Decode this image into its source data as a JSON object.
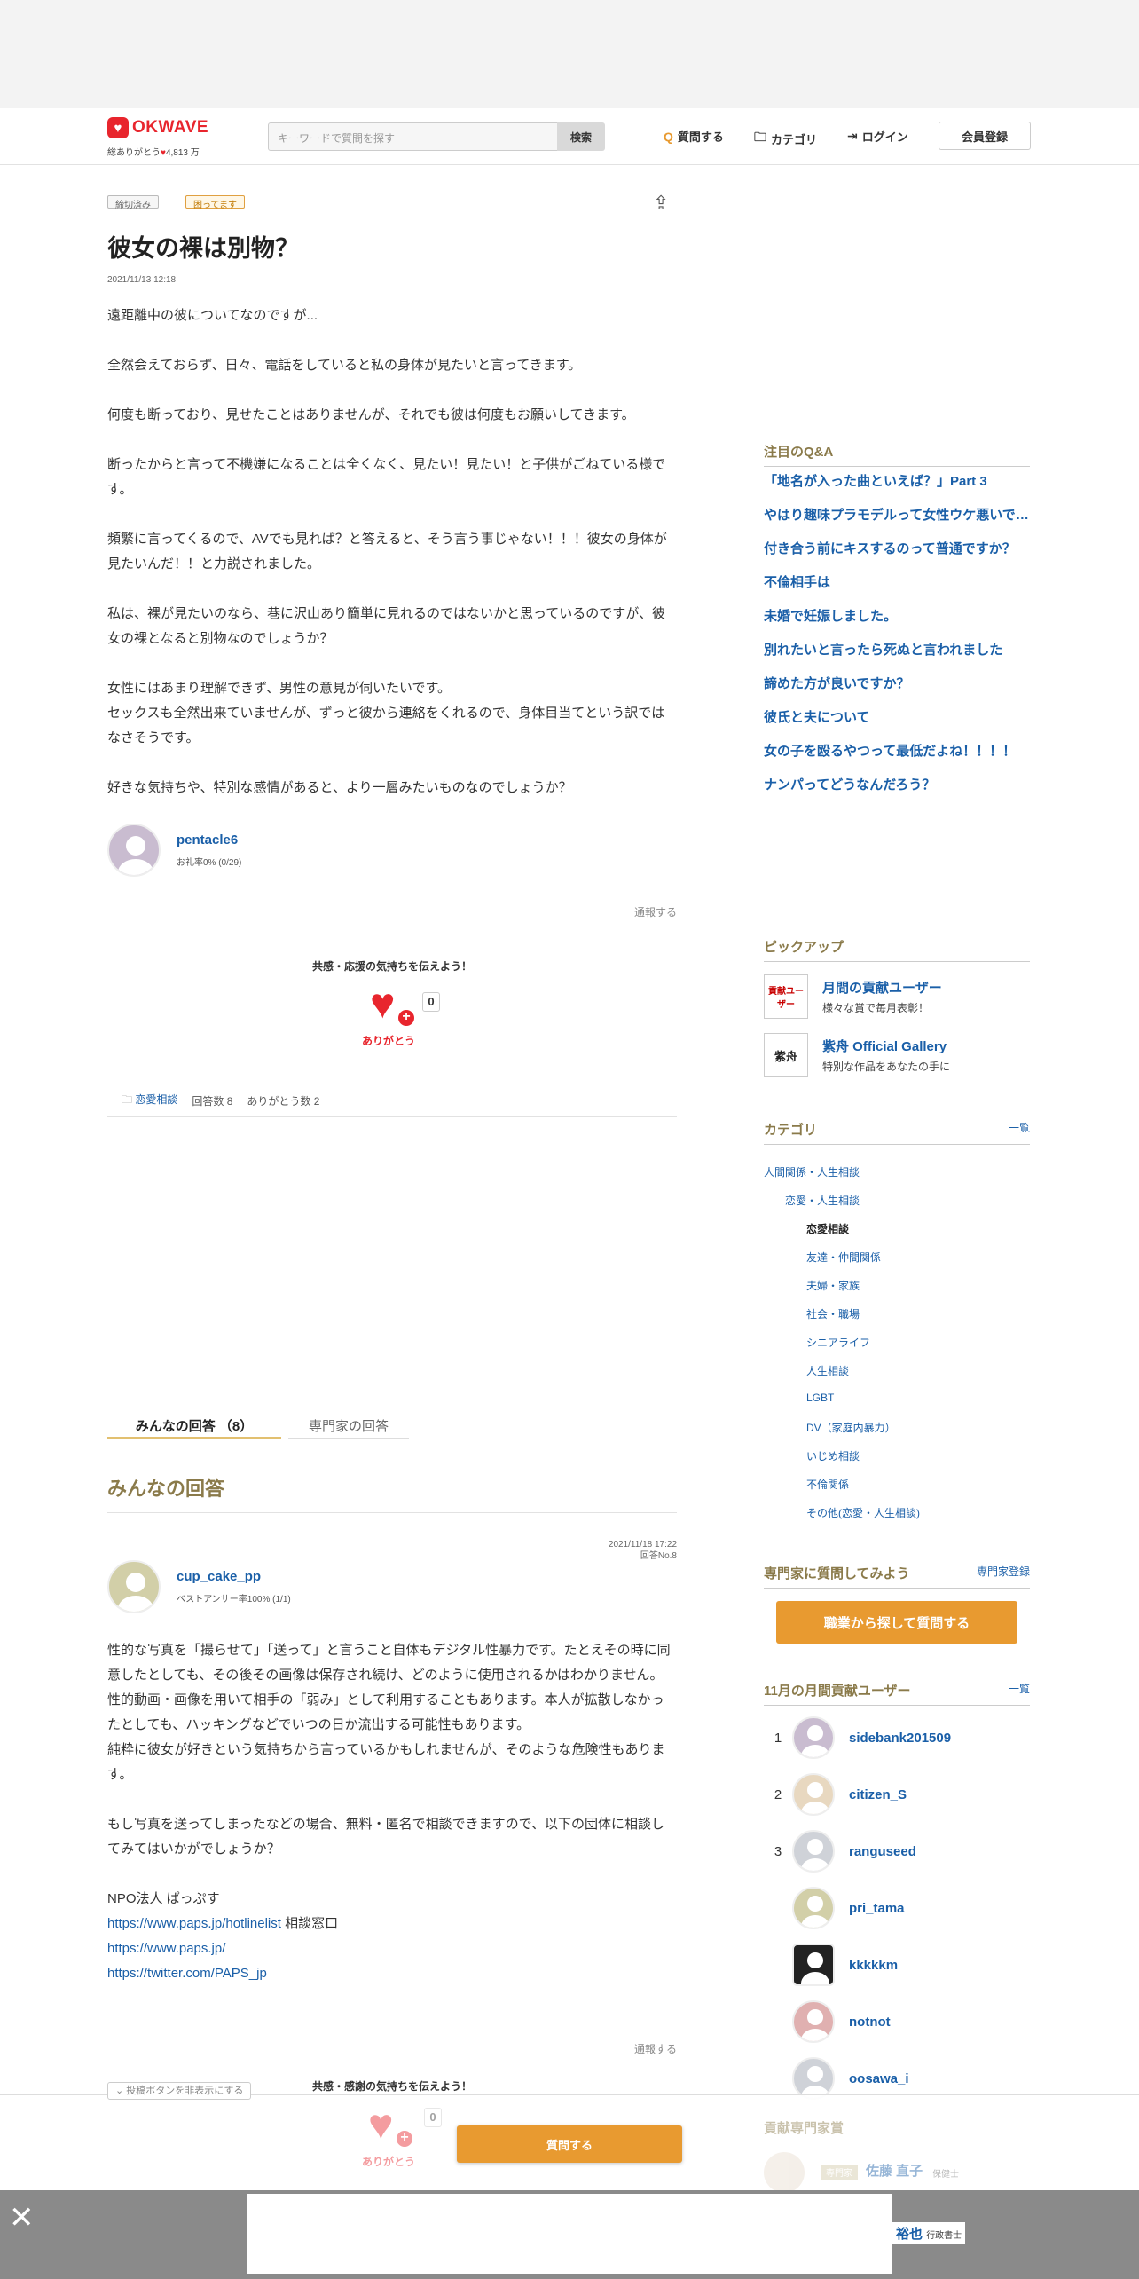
{
  "header": {
    "logo_text": "OKWAVE",
    "tagline_prefix": "総ありがとう",
    "tagline_count": "4,813 万",
    "search_placeholder": "キーワードで質問を探す",
    "search_button": "検索",
    "nav_ask": "質問する",
    "nav_category": "カテゴリ",
    "nav_login": "ログイン",
    "nav_register": "会員登録"
  },
  "question": {
    "tag_closed": "締切済み",
    "tag_trouble": "困ってます",
    "title": "彼女の裸は別物？",
    "date": "2021/11/13 12:18",
    "paragraphs": [
      "遠距離中の彼についてなのですが...",
      "全然会えておらず、日々、電話をしていると私の身体が見たいと言ってきます。",
      "何度も断っており、見せたことはありませんが、それでも彼は何度もお願いしてきます。",
      "断ったからと言って不機嫌になることは全くなく、見たい！見たい！と子供がごねている様です。",
      "頻繁に言ってくるので、AVでも見れば？と答えると、そう言う事じゃない！！！彼女の身体が見たいんだ！！と力説されました。",
      "私は、裸が見たいのなら、巷に沢山あり簡単に見れるのではないかと思っているのですが、彼女の裸となると別物なのでしょうか？",
      "女性にはあまり理解できず、男性の意見が伺いたいです。\nセックスも全然出来ていませんが、ずっと彼から連絡をくれるので、身体目当てという訳ではなさそうです。",
      "好きな気持ちや、特別な感情があると、より一層みたいものなのでしょうか？"
    ],
    "author": "pentacle6",
    "author_meta": "お礼率0% (0/29)",
    "report": "通報する",
    "cheer_text": "共感・応援の気持ちを伝えよう！",
    "thanks_count": "0",
    "thanks_label": "ありがとう",
    "category_link": "恋愛相談",
    "answer_count": "回答数 8",
    "thanks_total": "ありがとう数 2"
  },
  "tabs": {
    "everyone": "みんなの回答 （8）",
    "experts": "専門家の回答"
  },
  "answers_heading": "みんなの回答",
  "answer": {
    "date": "2021/11/18 17:22",
    "number": "回答No.8",
    "author": "cup_cake_pp",
    "author_meta": "ベストアンサー率100% (1/1)",
    "paragraph1": "性的な写真を「撮らせて」「送って」と言うこと自体もデジタル性暴力です。たとえその時に同意したとしても、その後その画像は保存され続け、どのように使用されるかはわかりません。\n性的動画・画像を用いて相手の「弱み」として利用することもあります。本人が拡散しなかったとしても、ハッキングなどでいつの日か流出する可能性もあります。\n純粋に彼女が好きという気持ちから言っているかもしれませんが、そのような危険性もあります。",
    "paragraph2": "もし写真を送ってしまったなどの場合、無料・匿名で相談できますので、以下の団体に相談してみてはいかがでしょうか？",
    "org_name": "NPO法人 ぱっぷす",
    "link1": "https://www.paps.jp/hotlinelist",
    "link1_suffix": " 相談窓口",
    "link2": "https://www.paps.jp/",
    "link3": "https://twitter.com/PAPS_jp",
    "report": "通報する",
    "cheer_text": "共感・感謝の気持ちを伝えよう！",
    "thanks_count": "0",
    "thanks_label": "ありがとう"
  },
  "sidebar": {
    "qa_title": "注目のQ&A",
    "qa_items": [
      "「地名が入った曲といえば？」Part 3",
      "やはり趣味プラモデルって女性ウケ悪いですか？",
      "付き合う前にキスするのって普通ですか？",
      "不倫相手は",
      "未婚で妊娠しました。",
      "別れたいと言ったら死ぬと言われました",
      "諦めた方が良いですか？",
      "彼氏と夫について",
      "女の子を殴るやつって最低だよね！！！！",
      "ナンパってどうなんだろう？"
    ],
    "pickup_title": "ピックアップ",
    "pickup": [
      {
        "badge": "貢献ユーザー",
        "title": "月間の貢献ユーザー",
        "sub": "様々な賞で毎月表彰！"
      },
      {
        "badge": "紫舟",
        "title": "紫舟 Official Gallery",
        "sub": "特別な作品をあなたの手に"
      }
    ],
    "category_title": "カテゴリ",
    "category_more": "一覧",
    "categories": [
      "人間関係・人生相談",
      "恋愛・人生相談",
      "恋愛相談",
      "友達・仲間関係",
      "夫婦・家族",
      "社会・職場",
      "シニアライフ",
      "人生相談",
      "LGBT",
      "DV（家庭内暴力）",
      "いじめ相談",
      "不倫関係",
      "その他(恋愛・人生相談)"
    ],
    "expert_title": "専門家に質問してみよう",
    "expert_register": "専門家登録",
    "expert_button": "職業から探して質問する",
    "ranking_title": "11月の月間貢献ユーザー",
    "ranking_more": "一覧",
    "ranking": [
      {
        "rank": "1",
        "name": "sidebank201509"
      },
      {
        "rank": "2",
        "name": "citizen_S"
      },
      {
        "rank": "3",
        "name": "ranguseed"
      },
      {
        "rank": "",
        "name": "pri_tama"
      },
      {
        "rank": "",
        "name": "kkkkkm"
      },
      {
        "rank": "",
        "name": "notnot"
      },
      {
        "rank": "",
        "name": "oosawa_i"
      }
    ],
    "contrib_experts_title": "貢献専門家賞",
    "expert1_badge": "専門家",
    "expert1_name": "佐藤 直子",
    "expert1_job": "保健士",
    "expert2_name": "裕也",
    "expert2_job": "行政書士"
  },
  "footer": {
    "hide_button": "投稿ボタンを非表示にする",
    "ask_button": "質問する",
    "close": "✕"
  }
}
